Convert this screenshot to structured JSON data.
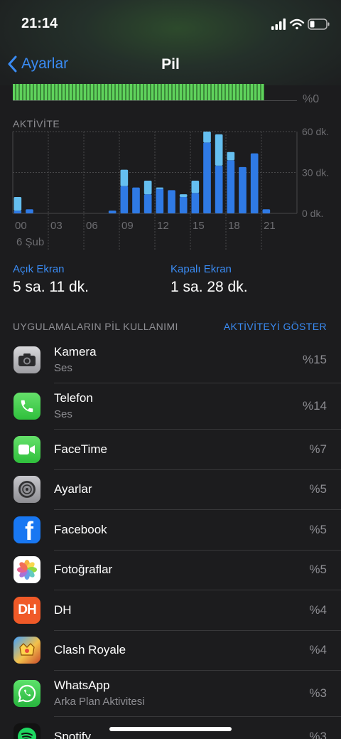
{
  "status": {
    "time": "21:14"
  },
  "nav": {
    "back_label": "Ayarlar",
    "title": "Pil"
  },
  "battery_level": {
    "axis_label": "%0"
  },
  "activity": {
    "title": "AKTİVİTE",
    "y_labels": [
      "60 dk.",
      "30 dk.",
      "0 dk."
    ],
    "x_labels": [
      "00",
      "03",
      "06",
      "09",
      "12",
      "15",
      "18",
      "21"
    ],
    "date_label": "6 Şub"
  },
  "chart_data": {
    "type": "bar",
    "title": "AKTİVİTE",
    "x": [
      "00",
      "01",
      "02",
      "03",
      "04",
      "05",
      "06",
      "07",
      "08",
      "09",
      "10",
      "11",
      "12",
      "13",
      "14",
      "15",
      "16",
      "17",
      "18",
      "19",
      "20",
      "21"
    ],
    "series": [
      {
        "name": "Açık Ekran",
        "color": "#2f7ae5",
        "values": [
          2,
          3,
          0,
          0,
          0,
          0,
          0,
          0,
          2,
          20,
          19,
          14,
          18,
          17,
          12,
          15,
          52,
          35,
          39,
          34,
          44,
          3
        ]
      },
      {
        "name": "Kapalı Ekran",
        "color": "#65bff0",
        "values": [
          10,
          0,
          0,
          0,
          0,
          0,
          0,
          0,
          0,
          12,
          0,
          10,
          1,
          0,
          2,
          9,
          8,
          23,
          6,
          0,
          0,
          0
        ]
      }
    ],
    "ylim": [
      0,
      60
    ],
    "y_ticks": [
      "60 dk.",
      "30 dk.",
      "0 dk."
    ]
  },
  "screen": {
    "on_label": "Açık Ekran",
    "on_value": "5 sa. 11 dk.",
    "off_label": "Kapalı Ekran",
    "off_value": "1 sa. 28 dk."
  },
  "usage": {
    "title": "UYGULAMALARIN PİL KULLANIMI",
    "show_activity": "AKTİVİTEYİ GÖSTER"
  },
  "apps": [
    {
      "name": "Kamera",
      "sub": "Ses",
      "pct": "%15",
      "icon": "camera-icon"
    },
    {
      "name": "Telefon",
      "sub": "Ses",
      "pct": "%14",
      "icon": "phone-icon"
    },
    {
      "name": "FaceTime",
      "sub": "",
      "pct": "%7",
      "icon": "facetime-icon"
    },
    {
      "name": "Ayarlar",
      "sub": "",
      "pct": "%5",
      "icon": "settings-icon"
    },
    {
      "name": "Facebook",
      "sub": "",
      "pct": "%5",
      "icon": "facebook-icon"
    },
    {
      "name": "Fotoğraflar",
      "sub": "",
      "pct": "%5",
      "icon": "photos-icon"
    },
    {
      "name": "DH",
      "sub": "",
      "pct": "%4",
      "icon": "dh-icon"
    },
    {
      "name": "Clash Royale",
      "sub": "",
      "pct": "%4",
      "icon": "clash-royale-icon"
    },
    {
      "name": "WhatsApp",
      "sub": "Arka Plan Aktivitesi",
      "pct": "%3",
      "icon": "whatsapp-icon"
    },
    {
      "name": "Spotify",
      "sub": "",
      "pct": "%3",
      "icon": "spotify-icon"
    }
  ],
  "colors": {
    "accent": "#3a8bf3",
    "battery_green": "#5fd35c"
  }
}
